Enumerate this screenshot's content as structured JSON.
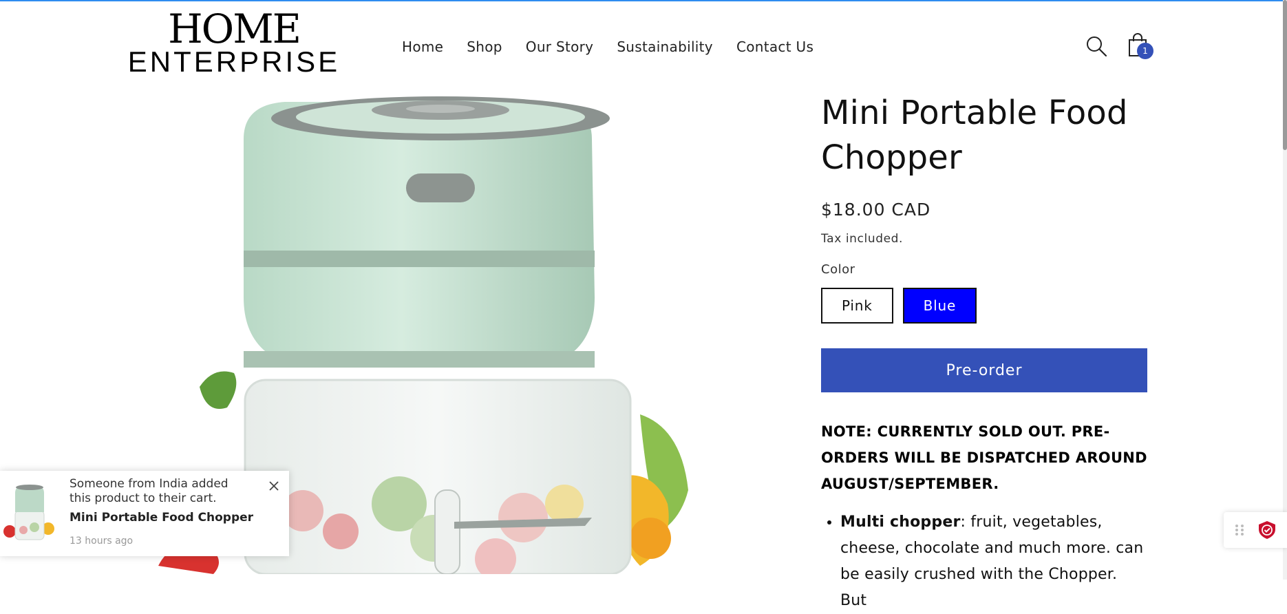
{
  "brand": {
    "line1": "HOME",
    "line2": "ENTERPRISE"
  },
  "nav": {
    "items": [
      "Home",
      "Shop",
      "Our Story",
      "Sustainability",
      "Contact Us"
    ]
  },
  "header": {
    "cart_count": "1",
    "search_icon": "search-icon",
    "cart_icon": "shopping-bag-icon"
  },
  "product": {
    "title": "Mini Portable Food Chopper",
    "price": "$18.00 CAD",
    "tax_note": "Tax included.",
    "color_label": "Color",
    "colors": [
      "Pink",
      "Blue"
    ],
    "selected_color": "Blue",
    "preorder_label": "Pre-order",
    "note": "NOTE: CURRENTLY SOLD OUT. PRE-ORDERS WILL BE DISPATCHED AROUND AUGUST/SEPTEMBER.",
    "bullet1_bold": "Multi chopper",
    "bullet1_text": ": fruit, vegetables, cheese, chocolate and much more. can be easily crushed with the Chopper. But"
  },
  "popup": {
    "message": "Someone from India added this product to their cart.",
    "product_name": "Mini Portable Food Chopper",
    "time": "13 hours ago",
    "close_icon": "close-icon"
  },
  "colors": {
    "accent": "#3451b8",
    "selected_swatch": "#0000ff",
    "badge_red": "#c8102e"
  }
}
